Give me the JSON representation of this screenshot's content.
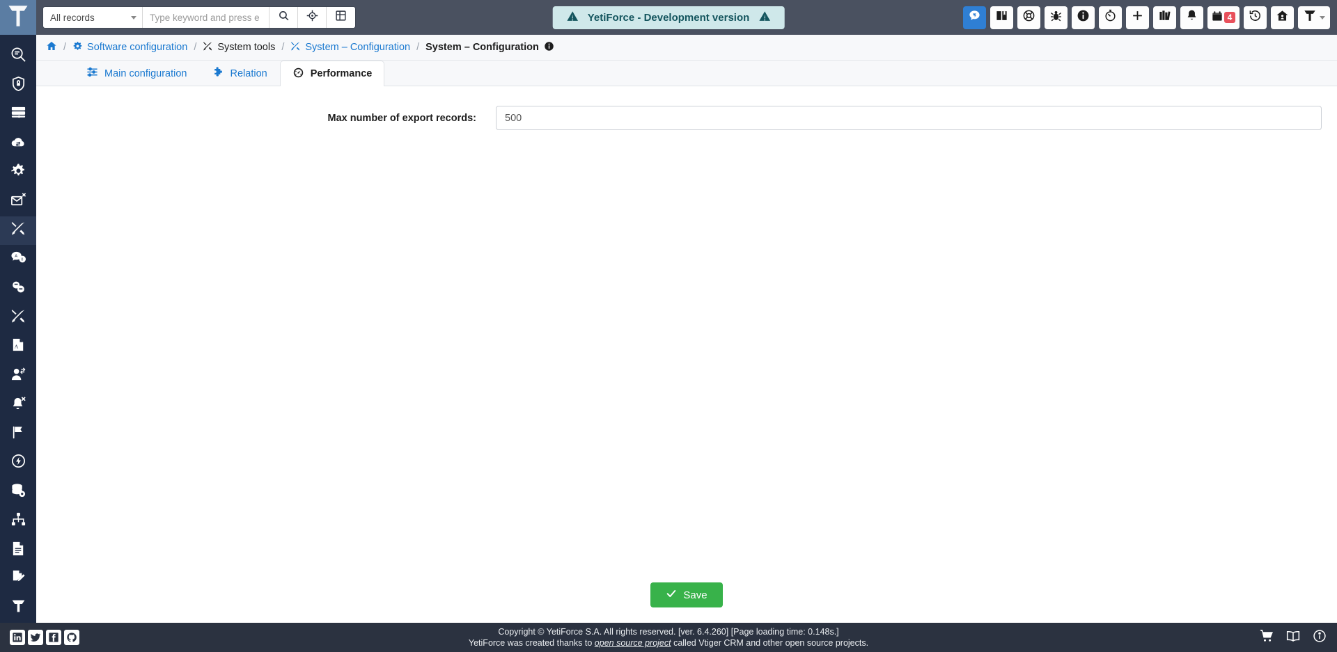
{
  "app": {
    "logo_icon": "yetiforce-logo-icon"
  },
  "topbar": {
    "records_filter": "All records",
    "search_placeholder": "Type keyword and press e",
    "search_value": "",
    "search_button_icon": "search-icon",
    "target_button_icon": "crosshair-icon",
    "grid_button_icon": "grid-icon",
    "dev_banner": {
      "text": "YetiForce - Development version",
      "left_icon": "warning-triangle-icon",
      "right_icon": "warning-triangle-icon",
      "bg_color": "#cfe8ea",
      "text_color": "#14555e"
    },
    "right_icons": [
      {
        "name": "chat-icon",
        "label": "Chat",
        "active": true,
        "accent": "#2f7fd4"
      },
      {
        "name": "book-icon",
        "label": "Documentation"
      },
      {
        "name": "life-ring-icon",
        "label": "Support"
      },
      {
        "name": "bug-icon",
        "label": "Report bug"
      },
      {
        "name": "info-circle-icon",
        "label": "Information"
      },
      {
        "name": "stopwatch-icon",
        "label": "Time control"
      },
      {
        "name": "plus-icon",
        "label": "Quick create"
      },
      {
        "name": "books-icon",
        "label": "Knowledge base"
      },
      {
        "name": "bell-icon",
        "label": "Notifications"
      },
      {
        "name": "calendar-icon",
        "label": "Calendar",
        "badge": "4",
        "badge_color": "#e8505b"
      },
      {
        "name": "history-icon",
        "label": "History"
      },
      {
        "name": "home-icon",
        "label": "Home"
      },
      {
        "name": "user-menu-icon",
        "label": "User menu",
        "has_caret": true
      }
    ]
  },
  "sidebar": {
    "items": [
      {
        "name": "sidebar-item-search-records",
        "icon": "list-search-icon",
        "label": "Search records",
        "active": false
      },
      {
        "name": "sidebar-item-security",
        "icon": "shield-lock-icon",
        "label": "Security",
        "active": false
      },
      {
        "name": "sidebar-item-database",
        "icon": "server-list-icon",
        "label": "Database",
        "active": false
      },
      {
        "name": "sidebar-item-integration",
        "icon": "cloud-exchange-icon",
        "label": "Integration",
        "active": false
      },
      {
        "name": "sidebar-item-automation",
        "icon": "cogs-icon",
        "label": "Automation",
        "active": false
      },
      {
        "name": "sidebar-item-mail",
        "icon": "envelope-x-icon",
        "label": "Mail",
        "active": false
      },
      {
        "name": "sidebar-item-system-tools",
        "icon": "tools-icon",
        "label": "System tools",
        "active": true
      },
      {
        "name": "sidebar-item-translations",
        "icon": "chat-translate-icon",
        "label": "Translations",
        "active": false
      },
      {
        "name": "sidebar-item-links",
        "icon": "link-icon",
        "label": "Links",
        "active": false
      },
      {
        "name": "sidebar-item-configuration",
        "icon": "tools-alt-icon",
        "label": "Configuration",
        "active": false
      },
      {
        "name": "sidebar-item-pdf",
        "icon": "pdf-icon",
        "label": "PDF",
        "active": false
      },
      {
        "name": "sidebar-item-users",
        "icon": "user-arrows-icon",
        "label": "Users",
        "active": false
      },
      {
        "name": "sidebar-item-notifications",
        "icon": "bell-slash-icon",
        "label": "Notifications",
        "active": false
      },
      {
        "name": "sidebar-item-flags",
        "icon": "flag-icon",
        "label": "Flags",
        "active": false
      },
      {
        "name": "sidebar-item-performance",
        "icon": "bolt-circle-icon",
        "label": "Performance",
        "active": false
      },
      {
        "name": "sidebar-item-backup",
        "icon": "database-gear-icon",
        "label": "Backup",
        "active": false
      },
      {
        "name": "sidebar-item-workflow",
        "icon": "sitemap-icon",
        "label": "Workflow",
        "active": false
      },
      {
        "name": "sidebar-item-logs",
        "icon": "file-lines-icon",
        "label": "Logs",
        "active": false
      },
      {
        "name": "sidebar-item-editor",
        "icon": "file-pen-icon",
        "label": "Editor",
        "active": false
      },
      {
        "name": "sidebar-item-branding",
        "icon": "yeti-mark-icon",
        "label": "Branding",
        "active": false
      }
    ]
  },
  "breadcrumb": {
    "home_icon": "home-icon",
    "items": [
      {
        "label": "Software configuration",
        "icon": "gear-icon",
        "link": true
      },
      {
        "label": "System tools",
        "icon": "tools-icon",
        "link": false
      },
      {
        "label": "System – Configuration",
        "icon": "tools-icon",
        "link": true
      },
      {
        "label": "System – Configuration",
        "icon": "",
        "link": false
      }
    ],
    "separator": "/",
    "info_icon": "info-circle-icon"
  },
  "tabs": [
    {
      "name": "tab-main-configuration",
      "label": "Main configuration",
      "icon": "sliders-icon",
      "active": false
    },
    {
      "name": "tab-relation",
      "label": "Relation",
      "icon": "puzzle-piece-icon",
      "active": false
    },
    {
      "name": "tab-performance",
      "label": "Performance",
      "icon": "tachometer-icon",
      "active": true
    }
  ],
  "form": {
    "fields": [
      {
        "name": "max-export-records",
        "label": "Max number of export records:",
        "value": "500",
        "placeholder": ""
      }
    ],
    "save_label": "Save",
    "save_icon": "check-icon",
    "save_color": "#38b24a"
  },
  "footer": {
    "social": [
      {
        "name": "linkedin-icon",
        "label": "LinkedIn"
      },
      {
        "name": "twitter-icon",
        "label": "Twitter"
      },
      {
        "name": "facebook-icon",
        "label": "Facebook"
      },
      {
        "name": "github-icon",
        "label": "GitHub"
      }
    ],
    "copyright_line1": "Copyright © YetiForce S.A. All rights reserved. [ver. 6.4.260] [Page loading time: 0.148s.]",
    "copyright_line2_before": "YetiForce was created thanks to ",
    "copyright_link": "open source project",
    "copyright_line2_after": " called Vtiger CRM and other open source projects.",
    "right_icons": [
      {
        "name": "shopping-cart-icon",
        "label": "Store"
      },
      {
        "name": "book-open-icon",
        "label": "Documentation"
      },
      {
        "name": "info-circle-icon",
        "label": "About"
      }
    ]
  }
}
